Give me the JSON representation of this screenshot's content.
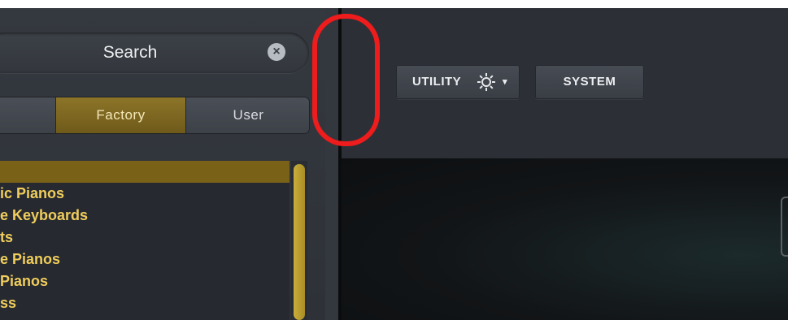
{
  "browser": {
    "search": {
      "placeholder": "Search",
      "clear_icon": "x-circle-icon"
    },
    "tabs": [
      {
        "label": ""
      },
      {
        "label": "Factory",
        "selected": true
      },
      {
        "label": "User"
      }
    ],
    "tree": {
      "items": [
        {
          "label": "",
          "selected": true
        },
        {
          "label": "ic Pianos"
        },
        {
          "label": "e Keyboards"
        },
        {
          "label": "ts"
        },
        {
          "label": "e Pianos"
        },
        {
          "label": "Pianos"
        },
        {
          "label": "ss"
        }
      ]
    }
  },
  "splitter": {
    "expand_icon": "chevron-right-icon"
  },
  "toolbar": {
    "utility_label": "UTILITY",
    "gear_icon": "gear-icon",
    "caret_icon": "▾",
    "system_label": "SYSTEM"
  },
  "colors": {
    "accent_gold": "#8c7428",
    "tree_text": "#f0cd5c",
    "highlight_ring": "#ee1c1c",
    "panel_bg": "#2b2f36"
  }
}
